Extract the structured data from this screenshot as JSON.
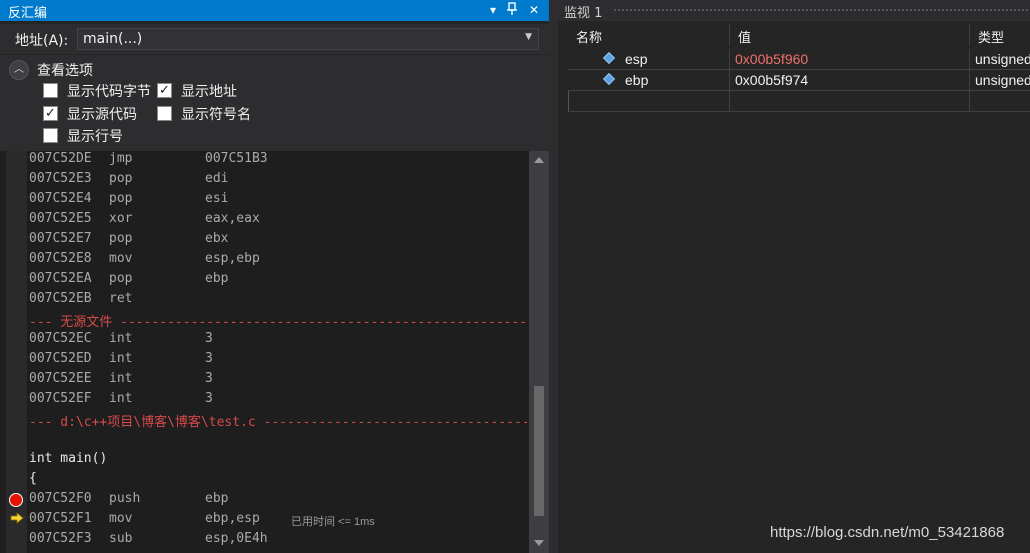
{
  "disassembly": {
    "title": "反汇编",
    "pin_glyph": "▾",
    "pin2_glyph": "⊥",
    "close_glyph": "✕",
    "address_label": "地址(A):",
    "address_value": "main(...)",
    "options": {
      "title": "查看选项",
      "items": [
        {
          "label": "显示代码字节",
          "checked": false
        },
        {
          "label": "显示地址",
          "checked": true
        },
        {
          "label": "显示源代码",
          "checked": true
        },
        {
          "label": "显示符号名",
          "checked": false
        },
        {
          "label": "显示行号",
          "checked": false
        }
      ]
    },
    "lines": [
      {
        "addr": "007C52DE",
        "mn": "jmp",
        "op": "007C51B3"
      },
      {
        "addr": "007C52E3",
        "mn": "pop",
        "op": "edi"
      },
      {
        "addr": "007C52E4",
        "mn": "pop",
        "op": "esi"
      },
      {
        "addr": "007C52E5",
        "mn": "xor",
        "op": "eax,eax"
      },
      {
        "addr": "007C52E7",
        "mn": "pop",
        "op": "ebx"
      },
      {
        "addr": "007C52E8",
        "mn": "mov",
        "op": "esp,ebp"
      },
      {
        "addr": "007C52EA",
        "mn": "pop",
        "op": "ebp"
      },
      {
        "addr": "007C52EB",
        "mn": "ret",
        "op": ""
      }
    ],
    "sep1": "--- 无源文件 ---------------------------------------------------------------------------",
    "lines2": [
      {
        "addr": "007C52EC",
        "mn": "int",
        "op": "3"
      },
      {
        "addr": "007C52ED",
        "mn": "int",
        "op": "3"
      },
      {
        "addr": "007C52EE",
        "mn": "int",
        "op": "3"
      },
      {
        "addr": "007C52EF",
        "mn": "int",
        "op": "3"
      }
    ],
    "sep2": "--- d:\\c++项目\\博客\\博客\\test.c ---------------------------------------------------------",
    "src1": "int main()",
    "src2": "{",
    "lines3": [
      {
        "addr": "007C52F0",
        "mn": "push",
        "op": "ebp",
        "time": ""
      },
      {
        "addr": "007C52F1",
        "mn": "mov",
        "op": "ebp,esp",
        "time": "已用时间 <= 1ms"
      },
      {
        "addr": "007C52F3",
        "mn": "sub",
        "op": "esp,0E4h",
        "time": ""
      }
    ]
  },
  "watch": {
    "title": "监视 1",
    "columns": [
      "名称",
      "值",
      "类型"
    ],
    "rows": [
      {
        "name": "esp",
        "value": "0x00b5f960",
        "type": "unsigned",
        "changed": true
      },
      {
        "name": "ebp",
        "value": "0x00b5f974",
        "type": "unsigned",
        "changed": false
      }
    ]
  },
  "colors": {
    "changed_value": "#f0706a",
    "normal_value": "#f1f1f1",
    "accent": "#007acc"
  },
  "watermark": "https://blog.csdn.net/m0_53421868"
}
